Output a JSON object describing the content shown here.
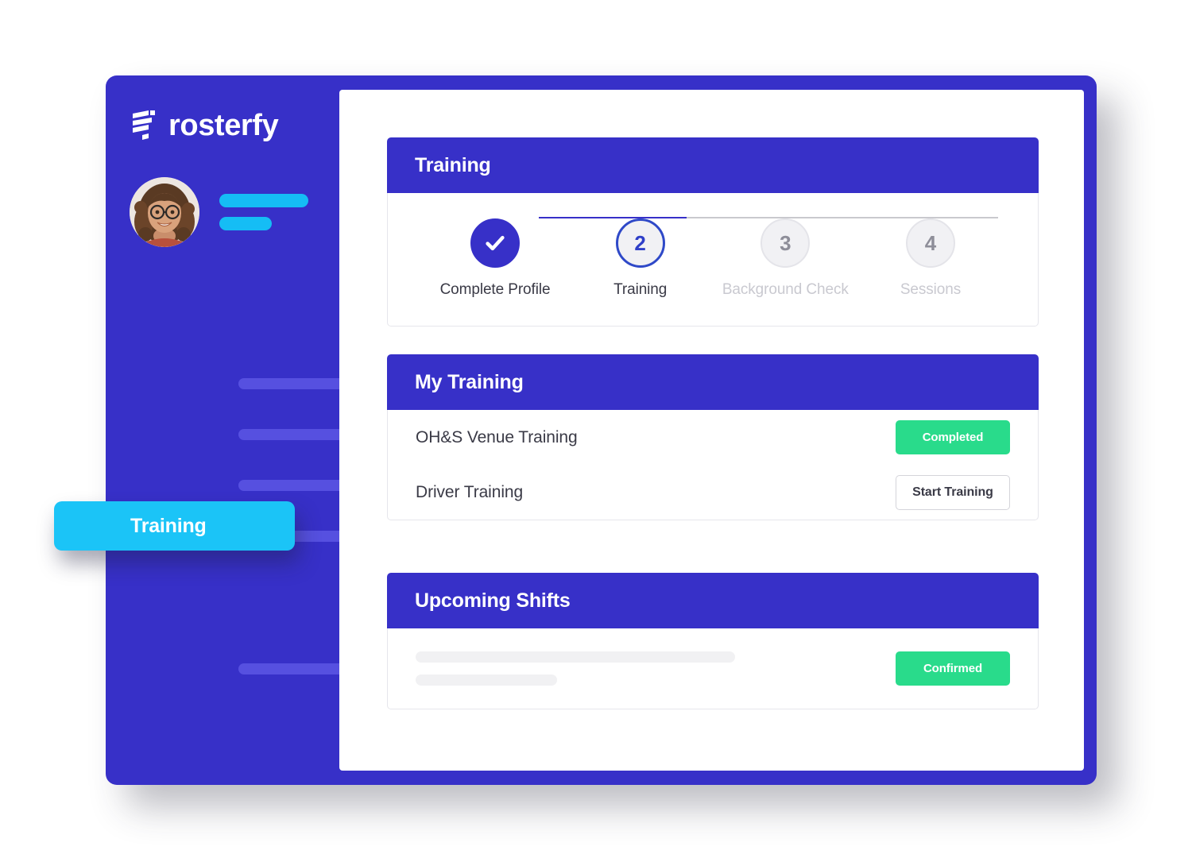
{
  "brand": {
    "name": "rosterfy",
    "logo_icon": "rosterfy-stacked-bars-icon"
  },
  "colors": {
    "primary_blue": "#3730C8",
    "accent_cyan": "#1BC4F7",
    "nav_placeholder": "#5650E0",
    "success_green": "#29DB8B",
    "step_inactive": "#F1F1F4",
    "step_inactive_text": "#8E8E99",
    "muted_label": "#C9C9D0"
  },
  "sidebar": {
    "profile": {
      "avatar_icon": "user-avatar-photo",
      "name_placeholder": "",
      "role_placeholder": ""
    },
    "items": [
      {
        "label": "",
        "active": false
      },
      {
        "label": "",
        "active": false
      },
      {
        "label": "",
        "active": false
      },
      {
        "label": "",
        "active": false
      },
      {
        "label": "Training",
        "active": true
      },
      {
        "label": "",
        "active": false
      }
    ],
    "active_item_label": "Training"
  },
  "main": {
    "training_card": {
      "title": "Training",
      "steps": [
        {
          "number": "1",
          "label": "Complete Profile",
          "state": "done",
          "icon": "check-icon"
        },
        {
          "number": "2",
          "label": "Training",
          "state": "current"
        },
        {
          "number": "3",
          "label": "Background Check",
          "state": "upcoming"
        },
        {
          "number": "4",
          "label": "Sessions",
          "state": "upcoming"
        }
      ]
    },
    "my_training_card": {
      "title": "My Training",
      "rows": [
        {
          "name": "OH&S Venue Training",
          "action_label": "Completed",
          "action_type": "badge"
        },
        {
          "name": "Driver Training",
          "action_label": "Start Training",
          "action_type": "button"
        }
      ]
    },
    "upcoming_shifts_card": {
      "title": "Upcoming Shifts",
      "rows": [
        {
          "line1": "",
          "line2": "",
          "action_label": "Confirmed",
          "action_type": "badge"
        }
      ]
    }
  }
}
